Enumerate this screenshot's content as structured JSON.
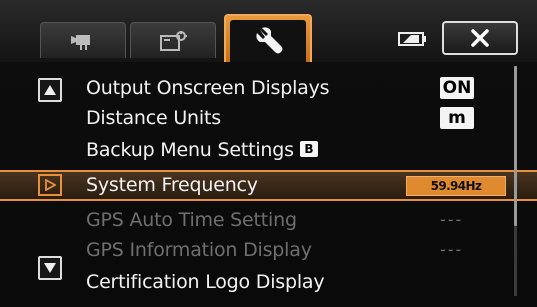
{
  "tabs": [
    {
      "label": "movie-mode-icon"
    },
    {
      "label": "playback-icon"
    },
    {
      "label": "setup-wrench-icon"
    }
  ],
  "menu": {
    "items": [
      {
        "label": "Output Onscreen Displays",
        "value": "ON"
      },
      {
        "label": "Distance Units",
        "value": "m"
      },
      {
        "label": "Backup Menu Settings",
        "badge": "B"
      },
      {
        "label": "System Frequency",
        "value": "59.94Hz"
      },
      {
        "label": "GPS Auto Time Setting",
        "value": "---"
      },
      {
        "label": "GPS Information Display",
        "value": "---"
      },
      {
        "label": "Certification Logo Display"
      }
    ]
  },
  "colors": {
    "accent": "#e8913a",
    "dimmed_text": "#6f6f6f"
  }
}
